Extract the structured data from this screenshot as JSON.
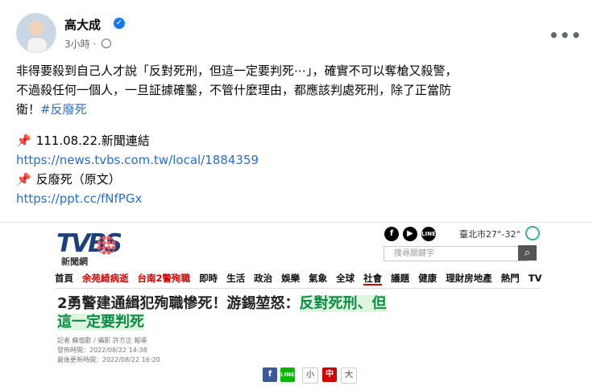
{
  "post": {
    "author": "高大成",
    "verified_icon": "check-badge-icon",
    "time": "3小時",
    "audience_icon": "globe-icon",
    "menu_icon": "more-horizontal-icon",
    "text_line_1": "非得要殺到自己人才說「反對死刑，但這一定要判死⋯」，確實不可以奪槍又殺警，",
    "text_line_2": "不過殺任何一個人，一旦証據確鑿，不管什麼理由，都應該判處死刑，除了正當防",
    "text_line_3": "衛！",
    "hashtag": "#反廢死",
    "news_label": "111.08.22.新聞連結",
    "news_url": "https://news.tvbs.com.tw/local/1884359",
    "source_label": "反廢死（原文）",
    "source_url": "https://ppt.cc/fNfPGx"
  },
  "article": {
    "logo": "TVBS",
    "logo_sub": "新聞網",
    "social_icons": [
      "facebook-icon",
      "youtube-icon",
      "line-icon"
    ],
    "weather": "臺北市27°-32°",
    "search_placeholder": "搜尋關鍵字",
    "search_icon": "search-icon",
    "nav_items": [
      "首頁",
      "余苑綺病逝",
      "台南2警殉職",
      "即時",
      "生活",
      "政治",
      "娛樂",
      "氣象",
      "全球",
      "社會",
      "議題",
      "健康",
      "理財房地產",
      "熱門",
      "TV"
    ],
    "headline_prefix": "2勇警建通緝犯殉職慘死！游錫堃怒：",
    "headline_highlight": "反對死刑、但這一定要判死",
    "reporter": "記者 蘇億歡 / 攝影 許方正 報導",
    "published": "發佈時間：2022/08/22 14:38",
    "updated": "最後更新時間：2022/08/22 16:20",
    "font_small": "小",
    "font_medium": "中",
    "font_large": "大"
  },
  "colors": {
    "link_blue": "#216fdb",
    "facebook_blue": "#1877f2",
    "tvbs_red": "#d50000",
    "highlight_green": "#dff4df"
  }
}
